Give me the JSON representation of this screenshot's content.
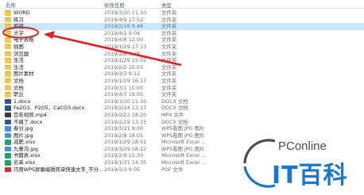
{
  "columns": {
    "name": "名称",
    "date": "修改日期",
    "type": "类型"
  },
  "rows": [
    {
      "name": "WORD",
      "date": "2019/3/20 11:10",
      "type": "文件夹",
      "size": "",
      "icon": "folder-icon"
    },
    {
      "name": "练习",
      "date": "2019/4/9 17:52",
      "type": "文件夹",
      "size": "",
      "icon": "folder-icon"
    },
    {
      "name": "如遮",
      "date": "2019/2/16 9:46",
      "type": "文件夹",
      "size": "",
      "icon": "folder-icon"
    },
    {
      "name": "大学",
      "date": "2019/4/1 9:04",
      "type": "文件夹",
      "size": "",
      "icon": "folder-icon"
    },
    {
      "name": "电子表格",
      "date": "2019/4/8 12:00",
      "type": "文件夹",
      "size": "",
      "icon": "folder-icon"
    },
    {
      "name": "插图",
      "date": "2019/1/29 17:13",
      "type": "文件夹",
      "size": "",
      "icon": "folder-icon"
    },
    {
      "name": "浏览器",
      "date": "2019/2/8 9:28",
      "type": "文件夹",
      "size": "",
      "icon": "folder-icon"
    },
    {
      "name": "生活",
      "date": "2019/1/29 15:02",
      "type": "文件夹",
      "size": "",
      "icon": "folder-icon"
    },
    {
      "name": "生活",
      "date": "2019/2/2 15:55",
      "type": "文件夹",
      "size": "",
      "icon": "folder-icon"
    },
    {
      "name": "图片素材",
      "date": "2019/3/3 9:12",
      "type": "文件夹",
      "size": "",
      "icon": "folder-icon"
    },
    {
      "name": "文档",
      "date": "2019/1/29 16:17",
      "type": "文件夹",
      "size": "",
      "icon": "folder-icon"
    },
    {
      "name": "文档",
      "date": "2019/3/1 15:00",
      "type": "文件夹",
      "size": "",
      "icon": "folder-icon"
    },
    {
      "name": "职业",
      "date": "2019/4/7 18:05",
      "type": "文件夹",
      "size": "",
      "icon": "folder-icon"
    },
    {
      "name": "1.docx",
      "date": "2019/3/20 11:10",
      "type": "DOCX 文档",
      "size": "",
      "icon": "word-icon"
    },
    {
      "name": "Fe2O3、P2O5、CaCO3.docx",
      "date": "2019/2/24 13:17",
      "type": "DOCX 文档",
      "size": "",
      "icon": "word-icon"
    },
    {
      "name": "百年视频.mp4",
      "date": "2019/2/22 18:20",
      "type": "MP4 文件",
      "size": "",
      "icon": "mp4-icon"
    },
    {
      "name": "不痛了.docx",
      "date": "2019/2/19 13:15",
      "type": "DOCX 文档",
      "size": "",
      "icon": "word-icon"
    },
    {
      "name": "春分.jpg",
      "date": "2019/3/21 9:00",
      "type": "WPS看图 JPG 图片",
      "size": "",
      "icon": "jpg-icon"
    },
    {
      "name": "图片.jpg",
      "date": "2019/2/8 18:05",
      "type": "WPS看图 JPG 图片",
      "size": "",
      "icon": "jpg-icon"
    },
    {
      "name": "减肥.xlsx",
      "date": "2019/1/29 18:01",
      "type": "Microsoft Excel ...",
      "size": "",
      "icon": "excel-icon"
    },
    {
      "name": "九寨沟.jpg",
      "date": "2019/3/29 18:22",
      "type": "WPS看图 JPG 图片",
      "size": "",
      "icon": "jpg-icon"
    },
    {
      "name": "书籍表.xlsx",
      "date": "2019/2/9 15:30",
      "type": "Microsoft Excel ...",
      "size": "",
      "icon": "excel-icon"
    },
    {
      "name": "名单.xlsx",
      "date": "2019/1/31 14:35",
      "type": "Microsoft Excel ...",
      "size": "",
      "icon": "excel-icon"
    },
    {
      "name": "巧用WPS屏幕编辑简单快速文字_不分...",
      "date": "2019/3/3 9:05",
      "type": "PDF 文件",
      "size": "",
      "icon": "pdf-icon"
    }
  ],
  "selected_index": 2,
  "watermark": {
    "pconline": "PConline",
    "brand": "IT百科"
  },
  "colors": {
    "selection": "#cce8ff",
    "annotation": "#e02020",
    "brand_blue": "#1677d2"
  }
}
